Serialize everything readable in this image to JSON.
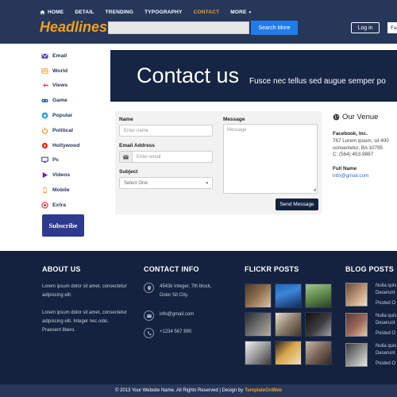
{
  "nav": {
    "items": [
      {
        "label": "HOME",
        "icon": "home-icon"
      },
      {
        "label": "DETAIL"
      },
      {
        "label": "TRENDING"
      },
      {
        "label": "TYPOGRAPHY"
      },
      {
        "label": "CONTACT",
        "active": true
      },
      {
        "label": "MORE",
        "caret": "▾"
      }
    ]
  },
  "header": {
    "logo": "Headlines!",
    "search_value": "",
    "search_button": "Search More",
    "login_button": "Log in",
    "fb_button": "Fa",
    "accent_color": "#f2a01f",
    "background_color": "#26375a"
  },
  "sidebar": {
    "items": [
      {
        "label": "Email",
        "icon": "envelope-icon"
      },
      {
        "label": "World",
        "icon": "world-icon"
      },
      {
        "label": "Views",
        "icon": "airplane-icon"
      },
      {
        "label": "Game",
        "icon": "gamepad-icon"
      },
      {
        "label": "Popular",
        "icon": "popular-icon"
      },
      {
        "label": "Political",
        "icon": "power-icon"
      },
      {
        "label": "Hollywood",
        "icon": "star-burst-icon"
      },
      {
        "label": "Pc",
        "icon": "monitor-icon"
      },
      {
        "label": "Videos",
        "icon": "play-icon"
      },
      {
        "label": "Mobile",
        "icon": "mobile-icon"
      },
      {
        "label": "Extra",
        "icon": "circle-plus-icon"
      }
    ],
    "subscribe_button": "Subscribe"
  },
  "banner": {
    "title": "Contact us",
    "subtitle": "Fusce nec tellus sed augue semper po"
  },
  "form": {
    "name_label": "Name",
    "name_placeholder": "Enter name",
    "email_label": "Email Address",
    "email_placeholder": "Enter email",
    "subject_label": "Subject",
    "subject_selected": "Select One:",
    "message_label": "Message",
    "message_placeholder": "Message",
    "send_button": "Send Message"
  },
  "venue": {
    "title": "Our Venue",
    "company": "Facebook, Inc.",
    "address_line1": "767 Lorem ipsum, sit 400",
    "address_line2": "consectetur, BA 10795",
    "phone": "C: (564) 453-9867",
    "full_name_label": "Full Name",
    "email": "info@gmail.com"
  },
  "footer": {
    "about": {
      "heading": "ABOUT US",
      "para1_line1": "Lorem ipsum dolor sit amet, consectetur",
      "para1_line2": "adipiscing elit",
      "para2_line1": "Lorem ipsum dolor sit amet, consectetur",
      "para2_line2": "adipiscing elit. Integer nec odio.",
      "para2_line3": "Praesent libero."
    },
    "contact": {
      "heading": "CONTACT INFO",
      "address_line1": "4543k Integer, 7th block,",
      "address_line2": "Dolor Sit City.",
      "email": "info@gmail.com",
      "phone": "+1234 567 890"
    },
    "flickr": {
      "heading": "FLICKR POSTS"
    },
    "blog": {
      "heading": "BLOG POSTS",
      "items": [
        {
          "line1": "Nulla quis",
          "line2": "Deserunt",
          "line3": "Posted O"
        },
        {
          "line1": "Nulla quis",
          "line2": "Deserunt",
          "line3": "Posted O"
        },
        {
          "line1": "Nulla quis",
          "line2": "Deserunt",
          "line3": "Posted O"
        }
      ]
    }
  },
  "copyright": {
    "text": "© 2013 Your Website Name. All Rights Reserved | Design by",
    "link": "TemplateOnWeb"
  }
}
